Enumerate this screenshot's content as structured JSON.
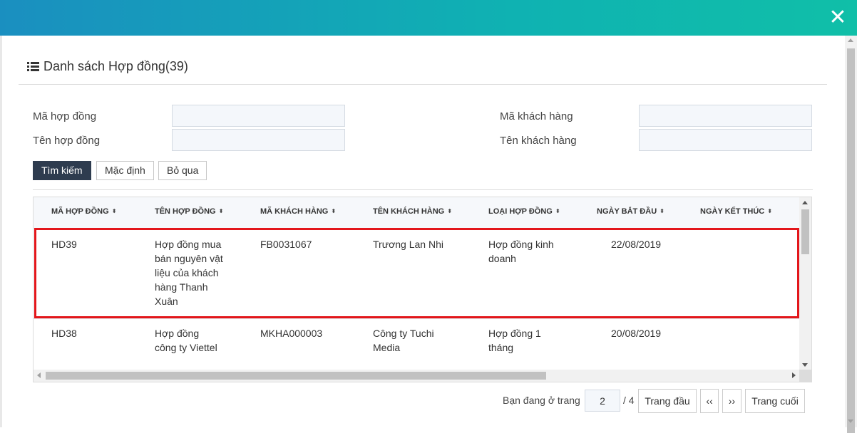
{
  "dialog": {
    "close_label": "✕",
    "title": "Danh sách Hợp đồng(39)"
  },
  "filters": {
    "contract_code_label": "Mã hợp đồng",
    "contract_name_label": "Tên hợp đồng",
    "customer_code_label": "Mã khách hàng",
    "customer_name_label": "Tên khách hàng",
    "contract_code_value": "",
    "contract_name_value": "",
    "customer_code_value": "",
    "customer_name_value": ""
  },
  "actions": {
    "search": "Tìm kiếm",
    "default": "Mặc định",
    "skip": "Bỏ qua"
  },
  "table": {
    "columns": [
      "MÃ HỢP ĐỒNG",
      "TÊN HỢP ĐỒNG",
      "MÃ KHÁCH HÀNG",
      "TÊN KHÁCH HÀNG",
      "LOẠI HỢP ĐỒNG",
      "NGÀY BẮT ĐẦU",
      "NGÀY KẾT THÚC"
    ],
    "sort_icon": "⬍",
    "rows": [
      {
        "code": "HD39",
        "name_lines": [
          "Hợp đồng mua",
          "bán nguyên vật",
          "liệu của khách",
          "hàng Thanh",
          "Xuân"
        ],
        "customer_code": "FB0031067",
        "customer_name": "Trương Lan Nhi",
        "type_lines": [
          "Hợp đồng kinh",
          "doanh"
        ],
        "start_date": "22/08/2019",
        "end_date": ""
      },
      {
        "code": "HD38",
        "name_lines": [
          "Hợp đồng",
          "công ty Viettel"
        ],
        "customer_code": "MKHA000003",
        "customer_name_lines": [
          "Công ty Tuchi",
          "Media"
        ],
        "type_lines": [
          "Hợp đồng 1",
          "tháng"
        ],
        "start_date": "20/08/2019",
        "end_date": ""
      }
    ]
  },
  "pager": {
    "prefix": "Bạn đang ở trang",
    "current_page": "2",
    "total": "/ 4",
    "first": "Trang đầu",
    "prev": "‹‹",
    "next": "››",
    "last": "Trang cuối"
  },
  "colors": {
    "header_start": "#1a8fc0",
    "header_end": "#10bfa8",
    "primary_button": "#2e3c4f",
    "highlight": "#e3161b"
  }
}
